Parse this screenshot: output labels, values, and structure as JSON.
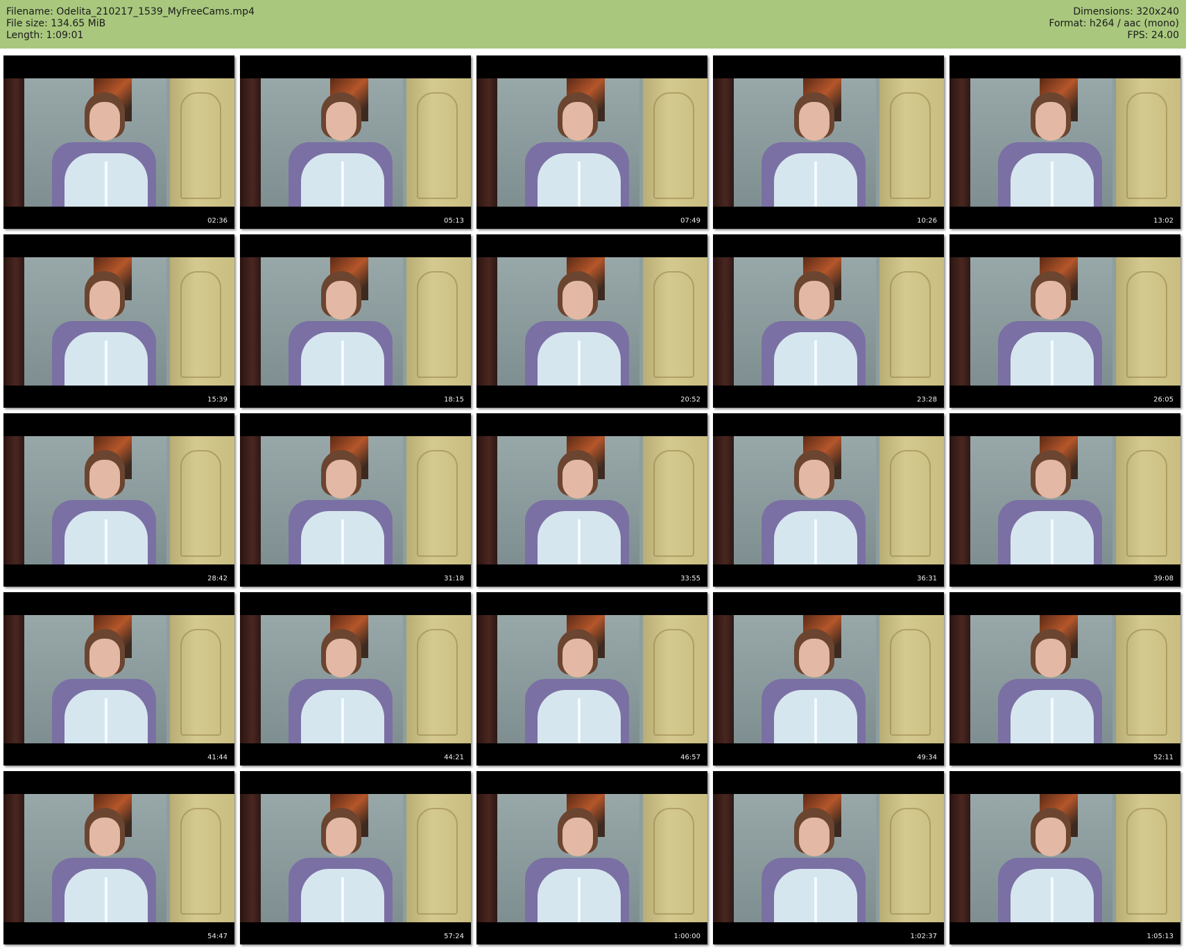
{
  "header": {
    "background_color": "#a9c87e",
    "filename_line": "Filename: Odelita_210217_1539_MyFreeCams.mp4",
    "filesize_line": "File size: 134.65 MiB",
    "length_line": "Length: 1:09:01",
    "dimensions_line": "Dimensions: 320x240",
    "format_line": "Format: h264 / aac (mono)",
    "fps_line": "FPS: 24.00"
  },
  "thumbnails": [
    {
      "time": "02:36"
    },
    {
      "time": "05:13"
    },
    {
      "time": "07:49"
    },
    {
      "time": "10:26"
    },
    {
      "time": "13:02"
    },
    {
      "time": "15:39"
    },
    {
      "time": "18:15"
    },
    {
      "time": "20:52"
    },
    {
      "time": "23:28"
    },
    {
      "time": "26:05"
    },
    {
      "time": "28:42"
    },
    {
      "time": "31:18"
    },
    {
      "time": "33:55"
    },
    {
      "time": "36:31"
    },
    {
      "time": "39:08"
    },
    {
      "time": "41:44"
    },
    {
      "time": "44:21"
    },
    {
      "time": "46:57"
    },
    {
      "time": "49:34"
    },
    {
      "time": "52:11"
    },
    {
      "time": "54:47"
    },
    {
      "time": "57:24"
    },
    {
      "time": "1:00:00"
    },
    {
      "time": "1:02:37"
    },
    {
      "time": "1:05:13"
    }
  ]
}
